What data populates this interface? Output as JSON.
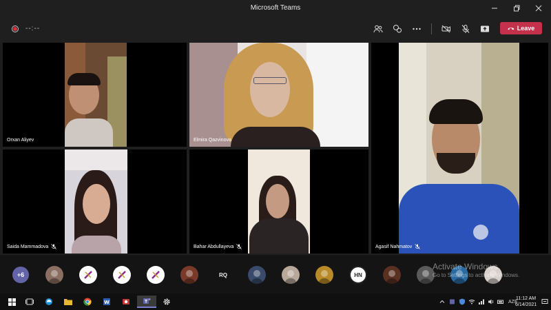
{
  "window": {
    "title": "Microsoft Teams"
  },
  "meeting": {
    "timer": "--:--",
    "leave_label": "Leave"
  },
  "participants": [
    {
      "name": "Orxan Aliyev",
      "muted": false
    },
    {
      "name": "Elmira Qazvinova",
      "muted": false
    },
    {
      "name": "Agasif Nahmatov",
      "muted": true
    },
    {
      "name": "Saida Mammadova",
      "muted": true
    },
    {
      "name": "Bahar Abdullayeva",
      "muted": true
    }
  ],
  "participant_bar": {
    "more_count": "+6",
    "avatars": [
      {
        "type": "photo",
        "bg": "#8a6f62"
      },
      {
        "type": "logo",
        "bg": "#ffffff"
      },
      {
        "type": "logo",
        "bg": "#ffffff"
      },
      {
        "type": "logo",
        "bg": "#ffffff"
      },
      {
        "type": "photo",
        "bg": "#7a3a2a"
      },
      {
        "type": "initials",
        "text": "RQ",
        "bg": "#141414"
      },
      {
        "type": "photo",
        "bg": "#3a4a6a"
      },
      {
        "type": "photo",
        "bg": "#b8a89a"
      },
      {
        "type": "photo",
        "bg": "#b88a2a"
      },
      {
        "type": "initials",
        "text": "HN",
        "bg": "#ffffff"
      },
      {
        "type": "photo",
        "bg": "#5a3020"
      },
      {
        "type": "photo",
        "bg": "#5a5a5a"
      },
      {
        "type": "photo",
        "bg": "#2a6aa0"
      },
      {
        "type": "photo",
        "bg": "#d8d0cc"
      }
    ]
  },
  "watermark": {
    "heading": "Activate Windows",
    "subtext": "Go to Settings to activate Windows."
  },
  "taskbar": {
    "language": "AZE",
    "time": "11:12 AM",
    "date": "6/14/2021"
  },
  "colors": {
    "leave": "#c4314b",
    "teams_accent": "#6264a7",
    "background": "#1f1f1f"
  }
}
